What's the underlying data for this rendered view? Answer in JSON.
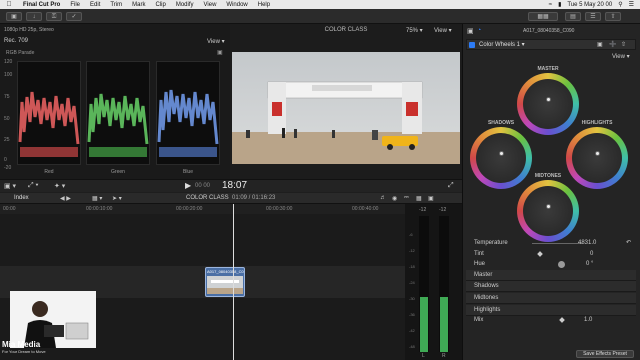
{
  "menubar": {
    "app": "Final Cut Pro",
    "items": [
      "File",
      "Edit",
      "Trim",
      "Mark",
      "Clip",
      "Modify",
      "View",
      "Window",
      "Help"
    ],
    "clock": "Tue 5 May  20 00"
  },
  "scopes": {
    "format": "1080p HD 25p, Stereo",
    "rec": "Rec. 709",
    "view_label": "View",
    "title": "RGB Parade",
    "ylabels": [
      "120",
      "100",
      "75",
      "50",
      "25",
      "0",
      "-20"
    ],
    "channels": [
      "Red",
      "Green",
      "Blue"
    ]
  },
  "viewer": {
    "title": "COLOR CLASS",
    "zoom": "75%",
    "view_label": "View"
  },
  "transport": {
    "timecode": "18:07"
  },
  "timeline": {
    "index_label": "Index",
    "title": "COLOR CLASS",
    "duration": "01:09 / 01:16:23",
    "ruler": [
      "00:00",
      "00:00:10:00",
      "00:00:20:00",
      "00:00:30:00",
      "00:00:40:00"
    ],
    "clip_label": "A017_08040358_C090",
    "meter_labels": [
      "-12",
      "-12"
    ],
    "meter_scale": [
      "-6",
      "-12",
      "-18",
      "-24",
      "-30",
      "-36",
      "-42",
      "-48"
    ],
    "meter_lr": [
      "L",
      "R"
    ]
  },
  "inspector": {
    "clip_name": "A017_08040358_C090",
    "effect": "Color Wheels 1",
    "view_label": "View",
    "wheels": [
      "MASTER",
      "SHADOWS",
      "HIGHLIGHTS",
      "MIDTONES"
    ],
    "params": [
      {
        "label": "Temperature",
        "value": "4831.0"
      },
      {
        "label": "Tint",
        "value": "0"
      },
      {
        "label": "Hue",
        "value": "0 °"
      }
    ],
    "sections": [
      "Master",
      "Shadows",
      "Midtones",
      "Highlights"
    ],
    "mix_label": "Mix",
    "mix_value": "1.0",
    "save_preset": "Save Effects Preset"
  },
  "brand": {
    "name": "Mia Media",
    "tagline": "For Your Dream to Move"
  },
  "colors": {
    "accent": "#2d7cf6",
    "clip": "#4a6fa5",
    "meter": "#3faa55"
  }
}
